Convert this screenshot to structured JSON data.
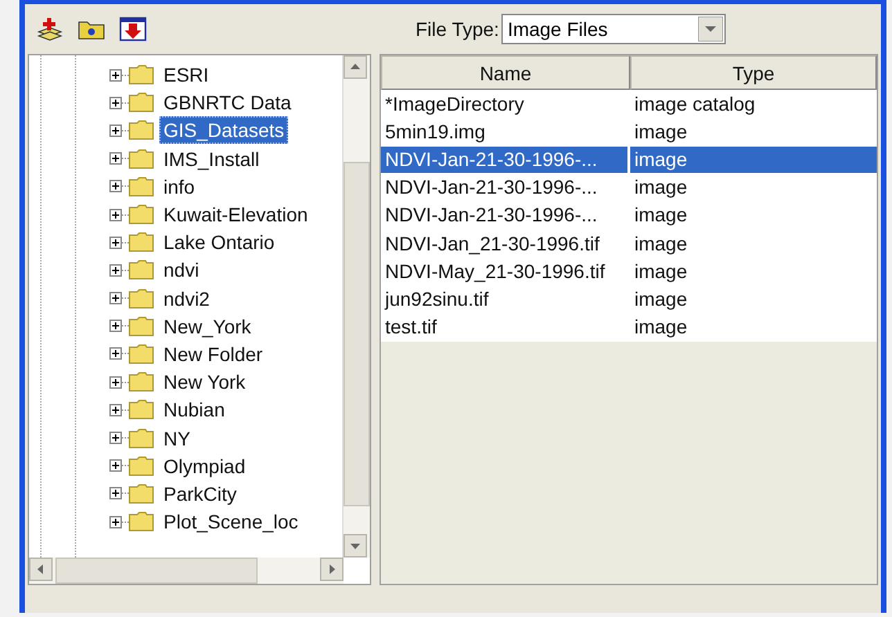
{
  "toolbar": {
    "file_type_label": "File Type:",
    "file_type_value": "Image Files"
  },
  "tree": {
    "items": [
      {
        "label": "ESRI",
        "expanded": false,
        "selected": false
      },
      {
        "label": "GBNRTC Data",
        "expanded": false,
        "selected": false
      },
      {
        "label": "GIS_Datasets",
        "expanded": false,
        "selected": true
      },
      {
        "label": "IMS_Install",
        "expanded": false,
        "selected": false
      },
      {
        "label": "info",
        "expanded": false,
        "selected": false
      },
      {
        "label": "Kuwait-Elevation",
        "expanded": false,
        "selected": false
      },
      {
        "label": "Lake Ontario",
        "expanded": false,
        "selected": false
      },
      {
        "label": "ndvi",
        "expanded": false,
        "selected": false
      },
      {
        "label": "ndvi2",
        "expanded": false,
        "selected": false
      },
      {
        "label": "New_York",
        "expanded": false,
        "selected": false
      },
      {
        "label": "New Folder",
        "expanded": false,
        "selected": false
      },
      {
        "label": "New York",
        "expanded": false,
        "selected": false
      },
      {
        "label": "Nubian",
        "expanded": false,
        "selected": false
      },
      {
        "label": "NY",
        "expanded": false,
        "selected": false
      },
      {
        "label": "Olympiad",
        "expanded": false,
        "selected": false
      },
      {
        "label": "ParkCity",
        "expanded": false,
        "selected": false
      },
      {
        "label": "Plot_Scene_loc",
        "expanded": false,
        "selected": false
      }
    ]
  },
  "table": {
    "columns": [
      "Name",
      "Type"
    ],
    "rows": [
      {
        "name": "*ImageDirectory",
        "type": "image catalog",
        "selected": false
      },
      {
        "name": "5min19.img",
        "type": "image",
        "selected": false
      },
      {
        "name": "NDVI-Jan-21-30-1996-...",
        "type": "image",
        "selected": true
      },
      {
        "name": "NDVI-Jan-21-30-1996-...",
        "type": "image",
        "selected": false
      },
      {
        "name": "NDVI-Jan-21-30-1996-...",
        "type": "image",
        "selected": false
      },
      {
        "name": "NDVI-Jan_21-30-1996.tif",
        "type": "image",
        "selected": false
      },
      {
        "name": "NDVI-May_21-30-1996.tif",
        "type": "image",
        "selected": false
      },
      {
        "name": "jun92sinu.tif",
        "type": "image",
        "selected": false
      },
      {
        "name": "test.tif",
        "type": "image",
        "selected": false
      }
    ]
  }
}
